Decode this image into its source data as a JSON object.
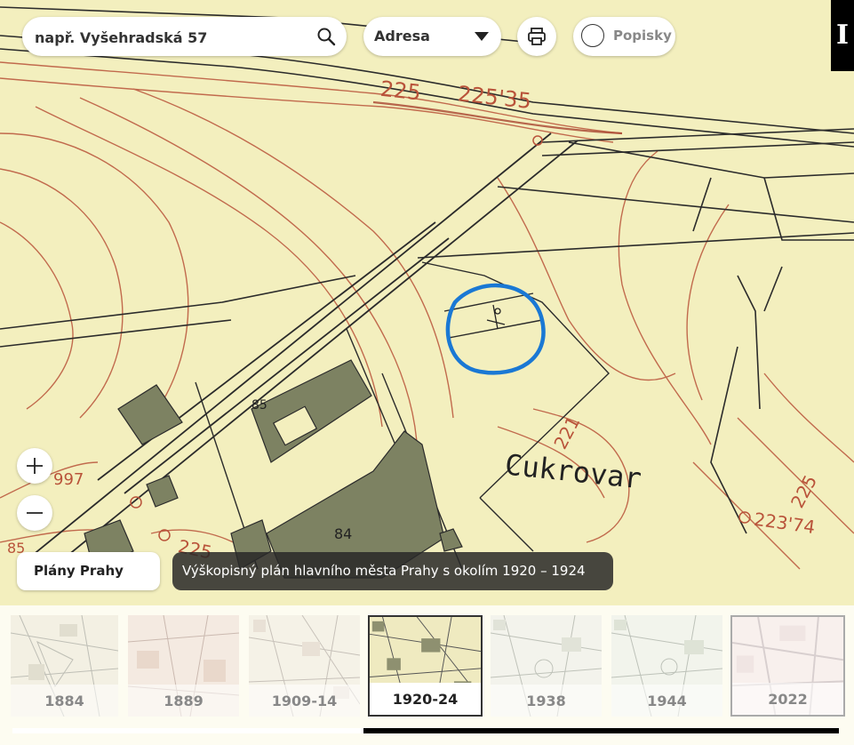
{
  "search": {
    "placeholder": "např. Vyšehradská 57",
    "value": ""
  },
  "mode_select": {
    "selected": "Adresa"
  },
  "labels_toggle": {
    "label": "Popisky",
    "checked": false
  },
  "logo": {
    "text": "I"
  },
  "zoom": {
    "in_symbol": "+",
    "out_symbol": "−"
  },
  "collection": {
    "label": "Plány Prahy"
  },
  "map_title": "Výškopisný plán hlavního města Prahy s okolím 1920 – 1924",
  "map_labels": {
    "elev_225": "225",
    "elev_225_35": "225'35",
    "elev_221": "221",
    "elev_225b": "225",
    "elev_223_74": "223'74",
    "elev_225c": "225",
    "elev_997": "997",
    "elev_85_left": "85",
    "num_85": "85",
    "num_84": "84",
    "place_name": "Cukrovar"
  },
  "timeline": {
    "items": [
      {
        "year": "1884",
        "active": false
      },
      {
        "year": "1889",
        "active": false
      },
      {
        "year": "1909-14",
        "active": false
      },
      {
        "year": "1920-24",
        "active": true
      },
      {
        "year": "1938",
        "active": false
      },
      {
        "year": "1944",
        "active": false
      },
      {
        "year": "2022",
        "active": false
      }
    ]
  },
  "colors": {
    "map_paper": "#f3efbe",
    "contour_red": "#b9533a",
    "building_olive": "#7d8262",
    "marker_blue": "#1a78d4",
    "dark_line": "#2b2b2b"
  }
}
